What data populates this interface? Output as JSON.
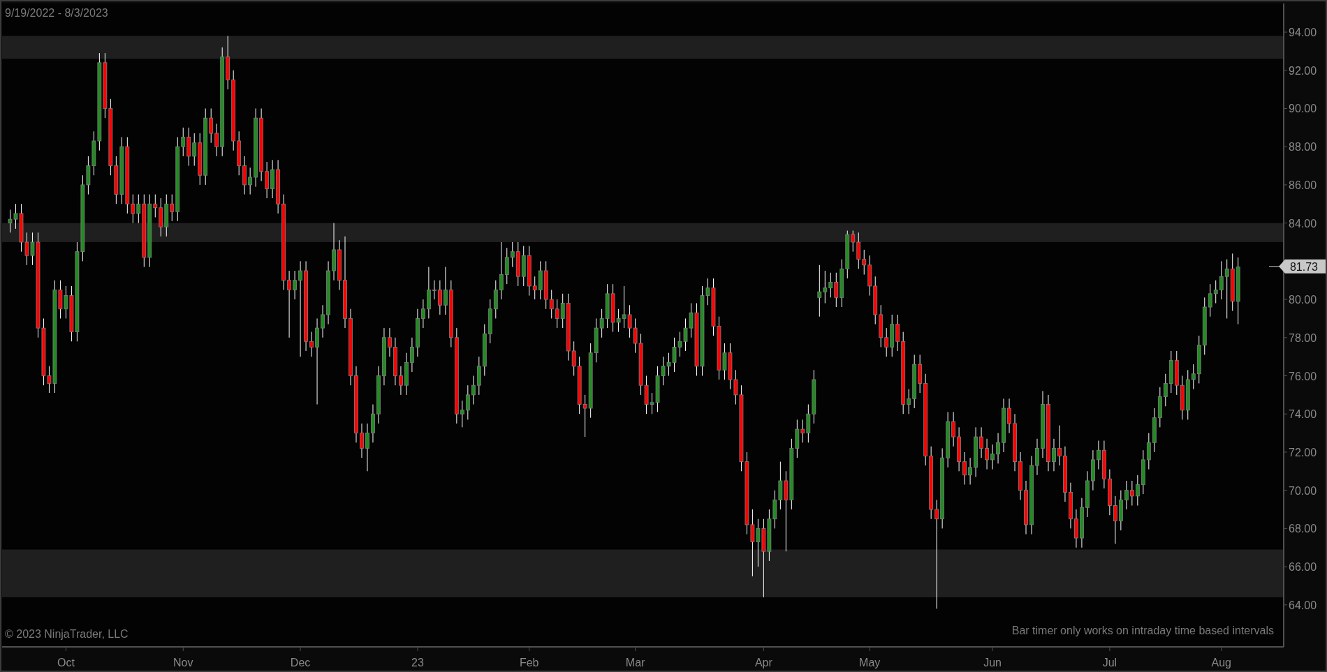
{
  "chart": {
    "date_range": "9/19/2022 - 8/3/2023",
    "copyright": "© 2023 NinjaTrader, LLC",
    "notice": "Bar timer only works on intraday time based intervals",
    "chart_data": {
      "type": "candlestick",
      "ylim": [
        61.8,
        95.5
      ],
      "yticks": [
        {
          "value": 64,
          "label": "64.00"
        },
        {
          "value": 66,
          "label": "66.00"
        },
        {
          "value": 68,
          "label": "68.00"
        },
        {
          "value": 70,
          "label": "70.00"
        },
        {
          "value": 72,
          "label": "72.00"
        },
        {
          "value": 74,
          "label": "74.00"
        },
        {
          "value": 76,
          "label": "76.00"
        },
        {
          "value": 78,
          "label": "78.00"
        },
        {
          "value": 80,
          "label": "80.00"
        },
        {
          "value": 84,
          "label": "84.00"
        },
        {
          "value": 86,
          "label": "86.00"
        },
        {
          "value": 88,
          "label": "88.00"
        },
        {
          "value": 90,
          "label": "90.00"
        },
        {
          "value": 92,
          "label": "92.00"
        },
        {
          "value": 94,
          "label": "94.00"
        }
      ],
      "categories": [
        null,
        null,
        null,
        null,
        null,
        null,
        null,
        null,
        null,
        null,
        "Oct",
        null,
        null,
        null,
        null,
        null,
        null,
        null,
        null,
        null,
        null,
        null,
        null,
        null,
        null,
        null,
        null,
        null,
        null,
        null,
        null,
        "Nov",
        null,
        null,
        null,
        null,
        null,
        null,
        null,
        null,
        null,
        null,
        null,
        null,
        null,
        null,
        null,
        null,
        null,
        null,
        null,
        null,
        "Dec",
        null,
        null,
        null,
        null,
        null,
        null,
        null,
        null,
        null,
        null,
        null,
        null,
        null,
        null,
        null,
        null,
        null,
        null,
        null,
        null,
        "23",
        null,
        null,
        null,
        null,
        null,
        null,
        null,
        null,
        null,
        null,
        null,
        null,
        null,
        null,
        null,
        null,
        null,
        null,
        null,
        "Feb",
        null,
        null,
        null,
        null,
        null,
        null,
        null,
        null,
        null,
        null,
        null,
        null,
        null,
        null,
        null,
        null,
        null,
        null,
        "Mar",
        null,
        null,
        null,
        null,
        null,
        null,
        null,
        null,
        null,
        null,
        null,
        null,
        null,
        null,
        null,
        null,
        null,
        null,
        null,
        null,
        null,
        null,
        "Apr",
        null,
        null,
        null,
        null,
        null,
        null,
        null,
        null,
        null,
        null,
        null,
        null,
        null,
        null,
        null,
        null,
        null,
        null,
        "May",
        null,
        null,
        null,
        null,
        null,
        null,
        null,
        null,
        null,
        null,
        null,
        null,
        null,
        null,
        null,
        null,
        null,
        null,
        null,
        null,
        null,
        "Jun",
        null,
        null,
        null,
        null,
        null,
        null,
        null,
        null,
        null,
        null,
        null,
        null,
        null,
        null,
        null,
        null,
        null,
        null,
        null,
        null,
        "Jul",
        null,
        null,
        null,
        null,
        null,
        null,
        null,
        null,
        null,
        null,
        null,
        null,
        null,
        null,
        null,
        null,
        null,
        null,
        null,
        "Aug",
        null,
        null,
        null
      ],
      "ohlc": [
        [
          84.0,
          84.7,
          83.5,
          84.2
        ],
        [
          84.2,
          85.0,
          83.7,
          84.5
        ],
        [
          84.5,
          85.0,
          82.5,
          83.0
        ],
        [
          83.0,
          83.5,
          81.8,
          82.3
        ],
        [
          82.3,
          83.5,
          81.8,
          83.0
        ],
        [
          83.0,
          83.5,
          78.0,
          78.5
        ],
        [
          78.5,
          79.0,
          75.5,
          76.0
        ],
        [
          76.0,
          76.5,
          75.1,
          75.6
        ],
        [
          75.6,
          81.0,
          75.1,
          80.5
        ],
        [
          80.5,
          81.0,
          79.0,
          79.5
        ],
        [
          79.5,
          80.7,
          79.0,
          80.2
        ],
        [
          80.2,
          80.7,
          77.8,
          78.3
        ],
        [
          78.3,
          83.0,
          77.8,
          82.5
        ],
        [
          82.5,
          86.5,
          82.0,
          86.0
        ],
        [
          86.0,
          87.5,
          85.5,
          87.0
        ],
        [
          87.0,
          88.8,
          86.5,
          88.3
        ],
        [
          88.3,
          92.9,
          87.8,
          92.4
        ],
        [
          92.4,
          92.9,
          89.5,
          90.0
        ],
        [
          90.0,
          90.5,
          86.5,
          87.0
        ],
        [
          87.0,
          87.5,
          85.0,
          85.5
        ],
        [
          85.5,
          88.5,
          85.0,
          88.0
        ],
        [
          88.0,
          88.5,
          84.5,
          85.0
        ],
        [
          85.0,
          85.5,
          84.0,
          84.5
        ],
        [
          84.5,
          85.5,
          84.0,
          85.0
        ],
        [
          85.0,
          85.5,
          81.7,
          82.2
        ],
        [
          82.2,
          85.5,
          81.7,
          85.0
        ],
        [
          85.0,
          85.5,
          84.3,
          84.8
        ],
        [
          84.8,
          85.3,
          83.3,
          83.8
        ],
        [
          83.8,
          85.5,
          83.3,
          85.0
        ],
        [
          85.0,
          85.5,
          84.1,
          84.6
        ],
        [
          84.6,
          88.5,
          84.1,
          88.0
        ],
        [
          88.0,
          89.0,
          87.5,
          88.5
        ],
        [
          88.5,
          89.0,
          87.0,
          87.5
        ],
        [
          87.5,
          88.7,
          87.0,
          88.2
        ],
        [
          88.2,
          88.7,
          86.0,
          86.5
        ],
        [
          86.5,
          90.0,
          86.0,
          89.5
        ],
        [
          89.5,
          90.0,
          88.2,
          88.7
        ],
        [
          88.7,
          89.2,
          87.5,
          88.0
        ],
        [
          88.0,
          93.2,
          87.5,
          92.7
        ],
        [
          92.7,
          93.8,
          91.0,
          91.5
        ],
        [
          91.5,
          92.0,
          87.8,
          88.3
        ],
        [
          88.3,
          88.8,
          86.5,
          87.0
        ],
        [
          87.0,
          87.5,
          85.5,
          86.0
        ],
        [
          86.0,
          86.9,
          85.5,
          86.4
        ],
        [
          86.4,
          90.0,
          85.9,
          89.5
        ],
        [
          89.5,
          90.0,
          86.2,
          86.7
        ],
        [
          86.7,
          87.2,
          85.3,
          85.8
        ],
        [
          85.8,
          87.3,
          85.3,
          86.8
        ],
        [
          86.8,
          87.3,
          84.5,
          85.0
        ],
        [
          85.0,
          85.5,
          80.5,
          81.0
        ],
        [
          81.0,
          81.5,
          78.0,
          80.5
        ],
        [
          80.5,
          81.5,
          80.0,
          81.0
        ],
        [
          81.0,
          82.0,
          77.0,
          81.5
        ],
        [
          81.5,
          82.0,
          77.3,
          77.8
        ],
        [
          77.8,
          78.3,
          77.0,
          77.5
        ],
        [
          77.5,
          79.0,
          74.5,
          78.5
        ],
        [
          78.5,
          79.7,
          78.0,
          79.2
        ],
        [
          79.2,
          82.0,
          78.7,
          81.5
        ],
        [
          81.5,
          84.0,
          81.0,
          82.6
        ],
        [
          82.6,
          83.1,
          80.5,
          81.0
        ],
        [
          81.0,
          83.3,
          78.5,
          79.0
        ],
        [
          79.0,
          79.5,
          75.5,
          76.0
        ],
        [
          76.0,
          76.5,
          72.5,
          73.0
        ],
        [
          73.0,
          73.5,
          71.7,
          72.2
        ],
        [
          72.2,
          73.5,
          71.0,
          73.0
        ],
        [
          73.0,
          74.5,
          72.5,
          74.0
        ],
        [
          74.0,
          76.5,
          73.5,
          76.0
        ],
        [
          76.0,
          78.5,
          75.5,
          78.0
        ],
        [
          78.0,
          78.5,
          77.0,
          77.5
        ],
        [
          77.5,
          78.0,
          75.5,
          76.0
        ],
        [
          76.0,
          76.5,
          75.0,
          75.5
        ],
        [
          75.5,
          77.2,
          75.0,
          76.7
        ],
        [
          76.7,
          78.0,
          76.2,
          77.5
        ],
        [
          77.5,
          79.5,
          77.0,
          79.0
        ],
        [
          79.0,
          80.0,
          78.5,
          79.5
        ],
        [
          79.5,
          81.7,
          79.0,
          80.5
        ],
        [
          80.5,
          81.0,
          80.0,
          80.5
        ],
        [
          80.5,
          81.0,
          79.2,
          79.7
        ],
        [
          79.7,
          81.7,
          79.2,
          80.5
        ],
        [
          80.5,
          81.0,
          77.5,
          78.0
        ],
        [
          78.0,
          78.5,
          73.5,
          74.0
        ],
        [
          74.0,
          74.7,
          73.3,
          74.2
        ],
        [
          74.2,
          75.5,
          73.7,
          75.0
        ],
        [
          75.0,
          76.0,
          74.5,
          75.5
        ],
        [
          75.5,
          77.0,
          75.0,
          76.5
        ],
        [
          76.5,
          78.7,
          76.0,
          78.2
        ],
        [
          78.2,
          80.0,
          77.7,
          79.5
        ],
        [
          79.5,
          81.0,
          79.0,
          80.5
        ],
        [
          80.5,
          83.0,
          80.0,
          81.3
        ],
        [
          81.3,
          82.7,
          80.8,
          82.2
        ],
        [
          82.2,
          83.0,
          81.7,
          82.5
        ],
        [
          82.5,
          83.0,
          80.7,
          81.2
        ],
        [
          81.2,
          82.8,
          80.7,
          82.3
        ],
        [
          82.3,
          82.8,
          80.2,
          80.7
        ],
        [
          80.7,
          81.2,
          80.0,
          80.5
        ],
        [
          80.5,
          82.0,
          80.0,
          81.5
        ],
        [
          81.5,
          82.0,
          79.5,
          80.0
        ],
        [
          80.0,
          80.5,
          79.0,
          79.5
        ],
        [
          79.5,
          80.0,
          78.5,
          79.0
        ],
        [
          79.0,
          80.3,
          78.5,
          79.8
        ],
        [
          79.8,
          80.3,
          76.8,
          77.3
        ],
        [
          77.3,
          77.8,
          76.0,
          76.5
        ],
        [
          76.5,
          77.0,
          74.0,
          74.5
        ],
        [
          74.5,
          75.0,
          72.8,
          74.3
        ],
        [
          74.3,
          77.7,
          73.8,
          77.2
        ],
        [
          77.2,
          79.0,
          76.7,
          78.5
        ],
        [
          78.5,
          79.5,
          78.0,
          79.0
        ],
        [
          79.0,
          80.8,
          78.5,
          80.3
        ],
        [
          80.3,
          80.8,
          78.3,
          78.8
        ],
        [
          78.8,
          79.5,
          78.3,
          79.0
        ],
        [
          79.0,
          80.7,
          78.5,
          79.2
        ],
        [
          79.2,
          79.7,
          78.0,
          78.5
        ],
        [
          78.5,
          79.0,
          77.2,
          77.7
        ],
        [
          77.7,
          78.2,
          75.0,
          75.5
        ],
        [
          75.5,
          76.0,
          74.0,
          74.5
        ],
        [
          74.5,
          75.1,
          74.0,
          74.6
        ],
        [
          74.6,
          76.5,
          74.1,
          76.0
        ],
        [
          76.0,
          77.0,
          75.5,
          76.5
        ],
        [
          76.5,
          77.2,
          76.0,
          76.7
        ],
        [
          76.7,
          78.0,
          76.2,
          77.5
        ],
        [
          77.5,
          78.3,
          77.0,
          77.8
        ],
        [
          77.8,
          79.0,
          77.3,
          78.5
        ],
        [
          78.5,
          79.8,
          78.0,
          79.3
        ],
        [
          79.3,
          79.8,
          76.0,
          76.5
        ],
        [
          76.5,
          80.7,
          76.0,
          80.2
        ],
        [
          80.2,
          81.1,
          79.7,
          80.6
        ],
        [
          80.6,
          81.1,
          78.1,
          78.6
        ],
        [
          78.6,
          79.1,
          75.8,
          76.3
        ],
        [
          76.3,
          77.7,
          75.8,
          77.2
        ],
        [
          77.2,
          77.7,
          75.3,
          75.8
        ],
        [
          75.8,
          76.3,
          74.5,
          75.0
        ],
        [
          75.0,
          75.5,
          71.0,
          71.5
        ],
        [
          71.5,
          72.0,
          67.7,
          68.2
        ],
        [
          68.2,
          69.0,
          65.5,
          67.3
        ],
        [
          67.3,
          68.5,
          66.0,
          68.0
        ],
        [
          68.0,
          68.5,
          64.4,
          66.8
        ],
        [
          66.8,
          69.0,
          66.3,
          68.5
        ],
        [
          68.5,
          70.0,
          68.0,
          69.5
        ],
        [
          69.5,
          71.5,
          69.0,
          70.5
        ],
        [
          70.5,
          71.0,
          66.8,
          69.5
        ],
        [
          69.5,
          72.7,
          69.0,
          72.2
        ],
        [
          72.2,
          73.7,
          71.7,
          73.2
        ],
        [
          73.2,
          73.7,
          72.5,
          73.0
        ],
        [
          73.0,
          74.5,
          72.5,
          74.0
        ],
        [
          74.0,
          76.3,
          73.5,
          75.8
        ],
        [
          80.1,
          81.8,
          79.1,
          80.4
        ],
        [
          80.4,
          81.5,
          79.8,
          80.6
        ],
        [
          80.6,
          81.4,
          80.1,
          80.9
        ],
        [
          80.9,
          81.4,
          79.6,
          80.1
        ],
        [
          80.1,
          82.1,
          79.6,
          81.6
        ],
        [
          81.6,
          83.6,
          81.1,
          83.4
        ],
        [
          83.4,
          83.6,
          82.5,
          83.0
        ],
        [
          83.0,
          83.5,
          81.6,
          82.1
        ],
        [
          82.1,
          82.6,
          81.3,
          81.8
        ],
        [
          81.8,
          82.3,
          80.2,
          80.7
        ],
        [
          80.7,
          81.2,
          78.7,
          79.2
        ],
        [
          79.2,
          79.7,
          77.5,
          78.0
        ],
        [
          78.0,
          78.5,
          77.0,
          77.5
        ],
        [
          77.5,
          79.2,
          77.0,
          78.7
        ],
        [
          78.7,
          79.2,
          77.3,
          77.8
        ],
        [
          77.8,
          78.3,
          74.0,
          74.5
        ],
        [
          74.5,
          75.3,
          74.0,
          74.8
        ],
        [
          74.8,
          77.1,
          74.3,
          76.6
        ],
        [
          76.6,
          77.1,
          75.1,
          75.6
        ],
        [
          75.6,
          76.1,
          71.3,
          71.8
        ],
        [
          71.8,
          72.3,
          68.5,
          69.0
        ],
        [
          69.0,
          69.5,
          63.8,
          68.5
        ],
        [
          68.5,
          72.2,
          68.0,
          71.7
        ],
        [
          71.7,
          74.1,
          71.2,
          73.6
        ],
        [
          73.6,
          74.1,
          72.3,
          72.8
        ],
        [
          72.8,
          73.3,
          71.0,
          71.5
        ],
        [
          71.5,
          72.0,
          70.3,
          70.8
        ],
        [
          70.8,
          71.7,
          70.3,
          71.2
        ],
        [
          71.2,
          73.3,
          70.7,
          72.8
        ],
        [
          72.8,
          73.3,
          71.7,
          72.2
        ],
        [
          72.2,
          72.7,
          71.1,
          71.6
        ],
        [
          71.6,
          72.4,
          71.1,
          71.9
        ],
        [
          71.9,
          73.0,
          71.4,
          72.5
        ],
        [
          72.5,
          74.8,
          72.0,
          74.3
        ],
        [
          74.3,
          74.8,
          73.0,
          73.5
        ],
        [
          73.5,
          74.0,
          71.0,
          71.5
        ],
        [
          71.5,
          72.0,
          69.5,
          70.0
        ],
        [
          70.0,
          70.5,
          67.7,
          68.2
        ],
        [
          68.2,
          71.8,
          67.7,
          71.3
        ],
        [
          71.3,
          72.7,
          70.8,
          72.2
        ],
        [
          72.2,
          75.2,
          71.7,
          74.5
        ],
        [
          74.5,
          75.0,
          71.0,
          71.5
        ],
        [
          71.5,
          72.7,
          71.0,
          72.2
        ],
        [
          72.2,
          73.4,
          71.3,
          71.8
        ],
        [
          71.8,
          72.3,
          69.4,
          69.9
        ],
        [
          69.9,
          70.4,
          68.0,
          68.5
        ],
        [
          68.5,
          69.0,
          67.0,
          67.5
        ],
        [
          67.5,
          69.6,
          67.0,
          69.1
        ],
        [
          69.1,
          71.0,
          68.6,
          70.5
        ],
        [
          70.5,
          72.1,
          70.0,
          71.6
        ],
        [
          71.6,
          72.6,
          71.1,
          72.1
        ],
        [
          72.1,
          72.6,
          70.1,
          70.6
        ],
        [
          70.6,
          71.1,
          68.7,
          69.2
        ],
        [
          69.2,
          69.7,
          67.2,
          68.4
        ],
        [
          68.4,
          70.0,
          67.9,
          69.5
        ],
        [
          69.5,
          70.5,
          69.0,
          70.0
        ],
        [
          70.0,
          70.5,
          69.2,
          69.7
        ],
        [
          69.7,
          70.8,
          69.2,
          70.3
        ],
        [
          70.3,
          72.1,
          69.8,
          71.6
        ],
        [
          71.6,
          73.0,
          71.1,
          72.5
        ],
        [
          72.5,
          74.3,
          72.0,
          73.8
        ],
        [
          73.8,
          75.4,
          73.3,
          74.9
        ],
        [
          74.9,
          76.1,
          74.4,
          75.6
        ],
        [
          75.6,
          77.3,
          75.1,
          76.8
        ],
        [
          76.8,
          77.3,
          75.0,
          75.5
        ],
        [
          75.5,
          76.0,
          73.7,
          74.2
        ],
        [
          74.2,
          76.3,
          73.7,
          75.8
        ],
        [
          75.8,
          76.6,
          75.3,
          76.1
        ],
        [
          76.1,
          78.1,
          75.6,
          77.6
        ],
        [
          77.6,
          80.1,
          77.1,
          79.6
        ],
        [
          79.6,
          80.8,
          79.1,
          80.3
        ],
        [
          80.3,
          81.0,
          79.8,
          80.5
        ],
        [
          80.5,
          82.0,
          80.0,
          81.2
        ],
        [
          81.2,
          82.1,
          79.0,
          81.6
        ],
        [
          81.6,
          82.4,
          79.4,
          79.9
        ],
        [
          79.9,
          82.2,
          78.7,
          81.7
        ]
      ],
      "bands": [
        {
          "axis": "y",
          "from": 92.6,
          "to": 93.8
        },
        {
          "axis": "y",
          "from": 83.0,
          "to": 84.0
        },
        {
          "axis": "y",
          "from": 64.4,
          "to": 66.9
        }
      ],
      "ref_lines": [
        {
          "axis": "y",
          "value": 81.73,
          "label": "81.73"
        }
      ]
    }
  }
}
